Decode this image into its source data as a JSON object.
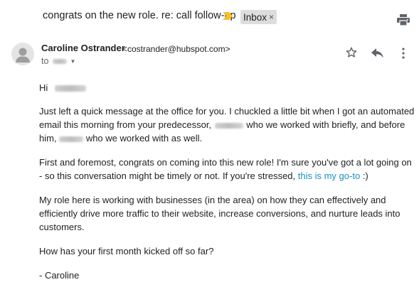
{
  "email": {
    "subject": "congrats on the new role. re: call follow-up",
    "label": "Inbox",
    "label_close": "×",
    "sender_name": "Caroline Ostrander",
    "sender_email": "<costrander@hubspot.com>",
    "to_prefix": "to",
    "greeting": "Hi",
    "para1_a": "Just left a quick message at the office for you. I chuckled a little bit when I got an automated email this morning from your predecessor,",
    "para1_b": "who we worked with briefly, and before him,",
    "para1_c": "who we worked with as well.",
    "para2_a": "First and foremost, congrats on coming into this new role! I'm sure you've got a lot going on - so this conversation might be timely or not. If you're stressed,",
    "para2_link": "this is my go-to",
    "para2_b": ":)",
    "para3": "My role here is working with businesses (in the area) on how they can effectively and efficiently drive more traffic to their website, increase conversions, and nurture leads into customers.",
    "para4": "How has your first month kicked off so far?",
    "signoff": "- Caroline"
  },
  "icons": {
    "importance": "importance-marker-icon",
    "print": "print-icon",
    "avatar": "default-avatar-icon",
    "star": "star-icon",
    "reply": "reply-icon",
    "more": "more-vertical-icon"
  },
  "colors": {
    "importance": "#f6c026",
    "label_bg": "#dddddd",
    "link": "#1a8fbf"
  }
}
